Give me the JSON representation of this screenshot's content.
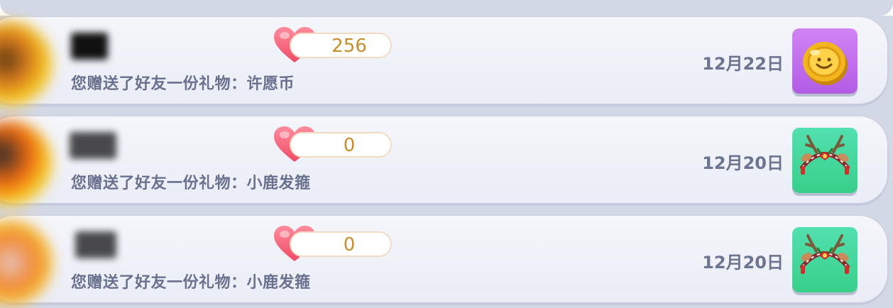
{
  "records": [
    {
      "likes": "256",
      "description": "您赠送了好友一份礼物：许愿币",
      "date": "12月22日",
      "gift_icon": "wish-coin-icon",
      "gift_bg": "#b25ce6"
    },
    {
      "likes": "0",
      "description": "您赠送了好友一份礼物：小鹿发箍",
      "date": "12月20日",
      "gift_icon": "deer-headband-icon",
      "gift_bg": "#38cf8a"
    },
    {
      "likes": "0",
      "description": "您赠送了好友一份礼物：小鹿发箍",
      "date": "12月20日",
      "gift_icon": "deer-headband-icon",
      "gift_bg": "#38cf8a"
    }
  ]
}
